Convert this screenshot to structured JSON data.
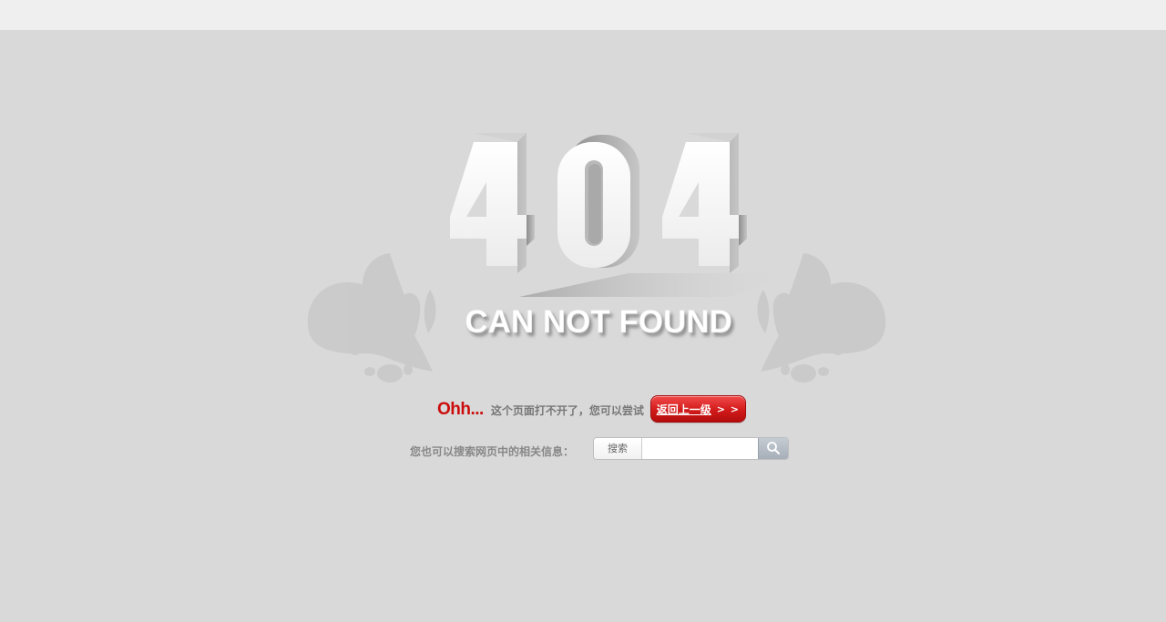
{
  "error": {
    "code_digits": [
      "4",
      "0",
      "4"
    ],
    "message": "CAN NOT FOUND"
  },
  "prompt": {
    "exclaim": "Ohh...",
    "hint": "这个页面打不开了，您可以尝试",
    "back_button": "返回上一级",
    "back_arrows": "> >"
  },
  "search": {
    "hint": "您也可以搜索网页中的相关信息：",
    "scope_label": "搜索",
    "value": "",
    "placeholder": "",
    "button_icon": "search-icon"
  },
  "colors": {
    "background": "#d9d9d9",
    "topbar": "#efefef",
    "accent_red": "#cc0d0d"
  }
}
